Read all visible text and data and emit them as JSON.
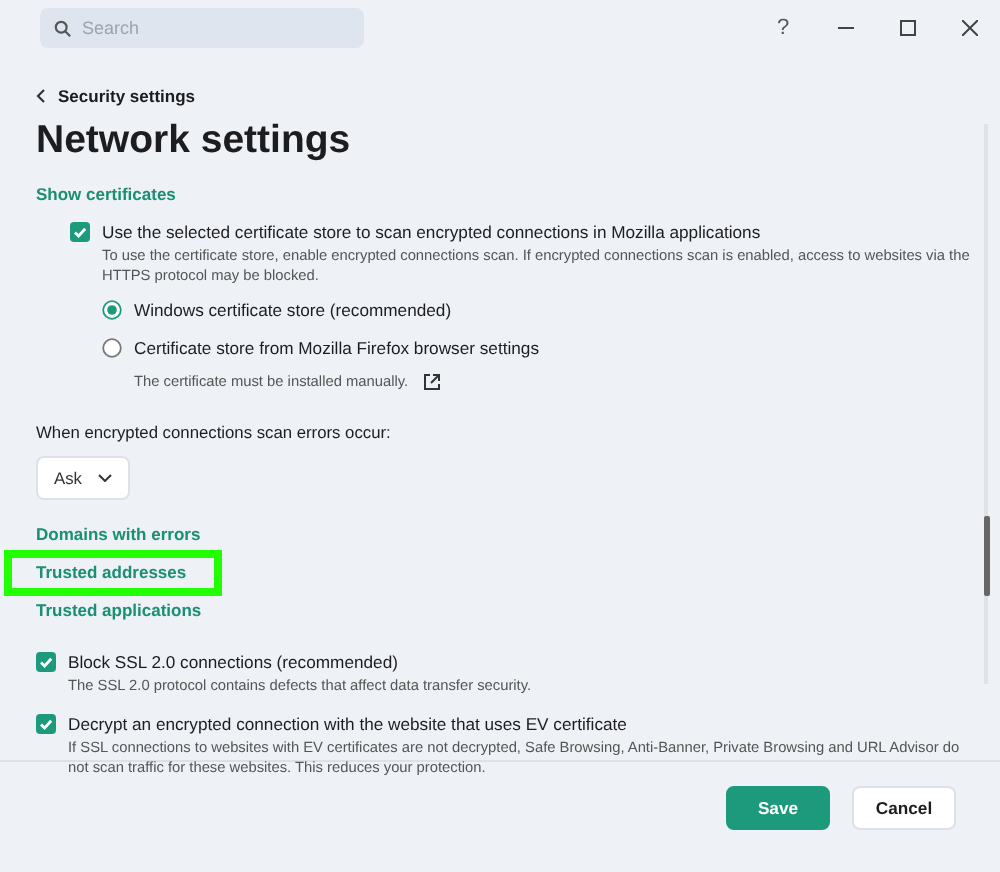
{
  "search": {
    "placeholder": "Search"
  },
  "help_button": "?",
  "breadcrumb": "Security settings",
  "title": "Network settings",
  "top_link": "Show certificates",
  "mozilla_option": {
    "label": "Use the selected certificate store to scan encrypted connections in Mozilla applications",
    "description": "To use the certificate store, enable encrypted connections scan. If encrypted connections scan is enabled, access to websites via the HTTPS protocol may be blocked.",
    "checked": true,
    "choices": [
      {
        "label": "Windows certificate store (recommended)",
        "selected": true
      },
      {
        "label": "Certificate store from Mozilla Firefox browser settings",
        "description": "The certificate must be installed manually.",
        "selected": false
      }
    ]
  },
  "scan_errors": {
    "label": "When encrypted connections scan errors occur:",
    "value": "Ask"
  },
  "links": [
    {
      "label": "Domains with errors",
      "highlighted": false
    },
    {
      "label": "Trusted addresses",
      "highlighted": true
    },
    {
      "label": "Trusted applications",
      "highlighted": false
    }
  ],
  "options": [
    {
      "label": "Block SSL 2.0 connections (recommended)",
      "description": "The SSL 2.0 protocol contains defects that affect data transfer security.",
      "checked": true
    },
    {
      "label": "Decrypt an encrypted connection with the website that uses EV certificate",
      "description": "If SSL connections to websites with EV certificates are not decrypted, Safe Browsing, Anti-Banner, Private Browsing and URL Advisor do not scan traffic for these websites. This reduces your protection.",
      "checked": true
    }
  ],
  "buttons": [
    {
      "label": "Save",
      "kind": "primary"
    },
    {
      "label": "Cancel",
      "kind": "secondary"
    }
  ]
}
